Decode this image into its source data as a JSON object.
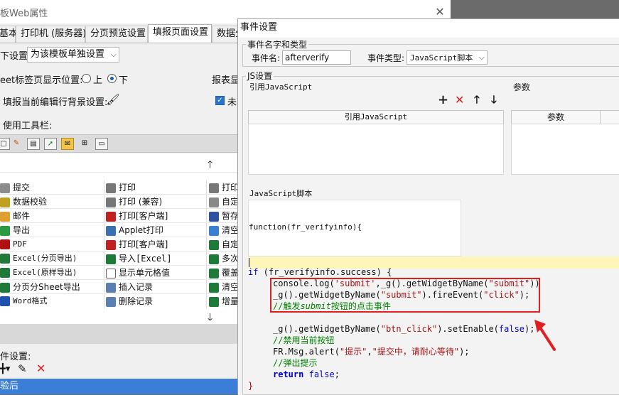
{
  "back_window": {
    "title": "板Web属性",
    "tabs": [
      "基本",
      "打印机 (服务器)",
      "分页预览设置",
      "填报页面设置",
      "数据分"
    ],
    "settings_label": "下设置:",
    "settings_value": "为该模板单独设置",
    "sheet_label": "eet标签页显示位置:",
    "radio_up": "上",
    "radio_down": "下",
    "report_label": "报表显",
    "fill_bg_label": "填报当前编辑行背景设置:",
    "unfilled_label": "未",
    "toolbar_label": "使用工具栏:",
    "col1": [
      "提交",
      "数据校验",
      "邮件",
      "导出",
      "PDF",
      "Excel(分页导出)",
      "Excel(原样导出)",
      "分页分Sheet导出",
      "Word格式"
    ],
    "col2": [
      "打印",
      "打印 (兼容)",
      "打印[客户端]",
      "Applet打印",
      "打印[客户端]",
      "导入[Excel]",
      "显示单元格值",
      "插入记录",
      "删除记录"
    ],
    "col3": [
      "打印",
      "自定",
      "暂存",
      "清空",
      "自定",
      "多次",
      "覆盖",
      "清空",
      "增量"
    ],
    "event_label": "件设置:",
    "selected_event": "验后"
  },
  "dialog": {
    "title": "事件设置",
    "group1_title": "事件名字和类型",
    "event_name_label": "事件名:",
    "event_name_value": "afterverify",
    "event_type_label": "事件类型:",
    "event_type_value": "JavaScript脚本",
    "group2_title": "JS设置",
    "ref_js_label": "引用JavaScript",
    "params_label": "参数",
    "ref_js_header": "引用JavaScript",
    "params_header": "参数",
    "js_script_label": "JavaScript脚本",
    "func_signature": "function(fr_verifyinfo){",
    "code": {
      "l1_kw": "if",
      "l1_rest": " (fr_verifyinfo.success) {",
      "l2_a": "console.log(",
      "l2_s1": "'submit'",
      "l2_b": ",_g().getWidgetByName(",
      "l2_s2": "\"submit\"",
      "l2_c": "))",
      "l3_a": "_g().getWidgetByName(",
      "l3_s1": "\"submit\"",
      "l3_b": ").fireEvent(",
      "l3_s2": "\"click\"",
      "l3_c": ");",
      "l4_a": "//触发",
      "l4_b": "submit",
      "l4_c": "按钮的点击事件",
      "l5_a": "_g().getWidgetByName(",
      "l5_s1": "\"btn_click\"",
      "l5_b": ").setEnable(",
      "l5_kw": "false",
      "l5_c": ");",
      "l6": "//禁用当前按钮",
      "l7_a": "FR.Msg.alert(",
      "l7_s1": "\"提示\"",
      "l7_b": ",",
      "l7_s2": "\"提交中，请耐心等待\"",
      "l7_c": ");",
      "l8": "//弹出提示",
      "l9_kw": "return",
      "l9_val": "false",
      "l9_c": ";",
      "l10": "}"
    }
  },
  "colors": {
    "accent": "#3b7ed8",
    "highlight": "#e02020",
    "keyword": "#0000cc",
    "string": "#a31515",
    "comment": "#008000"
  }
}
